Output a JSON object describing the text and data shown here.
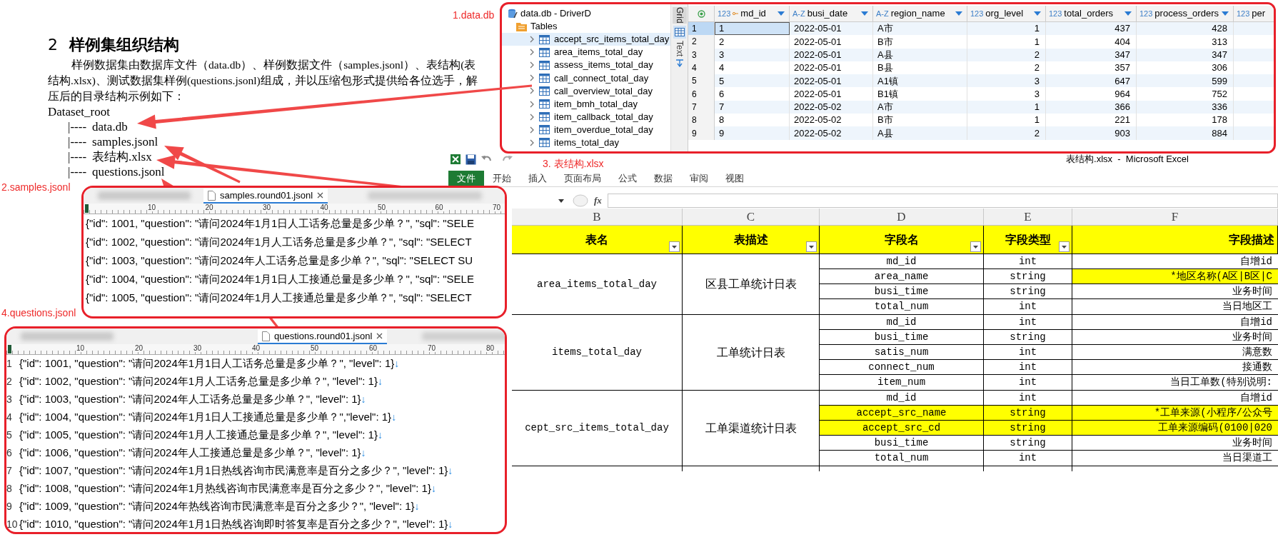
{
  "document": {
    "heading_number": "2",
    "heading": "样例集组织结构",
    "paragraph": "样例数据集由数据库文件（data.db）、样例数据文件（samples.jsonl）、表结构(表结构.xlsx)、测试数据集样例(questions.jsonl)组成，并以压缩包形式提供给各位选手，解压后的目录结构示例如下：",
    "tree_root": "Dataset_root",
    "tree": [
      {
        "prefix": "|----",
        "name": "data.db"
      },
      {
        "prefix": "|----",
        "name": "samples.jsonl"
      },
      {
        "prefix": "|----",
        "name": "表结构.xlsx"
      },
      {
        "prefix": "|----",
        "name": "questions.jsonl"
      }
    ]
  },
  "callout_labels": [
    "1.data.db",
    "2.samples.jsonl",
    "3. 表结构.xlsx",
    "4.questions.jsonl"
  ],
  "db_browser": {
    "title": "data.db - DriverD",
    "folder": "Tables",
    "tables": [
      {
        "name": "accept_src_items_total_day",
        "selected": true
      },
      {
        "name": "area_items_total_day",
        "selected": false
      },
      {
        "name": "assess_items_total_day",
        "selected": false
      },
      {
        "name": "call_connect_total_day",
        "selected": false
      },
      {
        "name": "call_overview_total_day",
        "selected": false
      },
      {
        "name": "item_bmh_total_day",
        "selected": false
      },
      {
        "name": "item_callback_total_day",
        "selected": false
      },
      {
        "name": "item_overdue_total_day",
        "selected": false
      },
      {
        "name": "items_total_day",
        "selected": false
      }
    ],
    "view_tabs": [
      {
        "label": "Grid",
        "selected": true
      },
      {
        "label": "Text",
        "selected": false
      }
    ],
    "columns": [
      {
        "type": "123",
        "name": "md_id",
        "key": true
      },
      {
        "type": "A-Z",
        "name": "busi_date",
        "key": false
      },
      {
        "type": "A-Z",
        "name": "region_name",
        "key": false
      },
      {
        "type": "123",
        "name": "org_level",
        "key": false
      },
      {
        "type": "123",
        "name": "total_orders",
        "key": false
      },
      {
        "type": "123",
        "name": "process_orders",
        "key": false
      },
      {
        "type": "123",
        "name": "per",
        "key": false
      }
    ],
    "rows": [
      {
        "number": "1",
        "selected": true,
        "cells": [
          "1",
          "2022-05-01",
          "A市",
          "1",
          "437",
          "428"
        ]
      },
      {
        "number": "2",
        "selected": false,
        "cells": [
          "2",
          "2022-05-01",
          "B市",
          "1",
          "404",
          "313"
        ]
      },
      {
        "number": "3",
        "selected": false,
        "cells": [
          "3",
          "2022-05-01",
          "A县",
          "2",
          "347",
          "347"
        ]
      },
      {
        "number": "4",
        "selected": false,
        "cells": [
          "4",
          "2022-05-01",
          "B县",
          "2",
          "357",
          "306"
        ]
      },
      {
        "number": "5",
        "selected": false,
        "cells": [
          "5",
          "2022-05-01",
          "A1镇",
          "3",
          "647",
          "599"
        ]
      },
      {
        "number": "6",
        "selected": false,
        "cells": [
          "6",
          "2022-05-01",
          "B1镇",
          "3",
          "964",
          "752"
        ]
      },
      {
        "number": "7",
        "selected": false,
        "cells": [
          "7",
          "2022-05-02",
          "A市",
          "1",
          "366",
          "336"
        ]
      },
      {
        "number": "8",
        "selected": false,
        "cells": [
          "8",
          "2022-05-02",
          "B市",
          "1",
          "221",
          "178"
        ]
      },
      {
        "number": "9",
        "selected": false,
        "cells": [
          "9",
          "2022-05-02",
          "A县",
          "2",
          "903",
          "884"
        ]
      }
    ]
  },
  "excel": {
    "window_title": "表结构.xlsx  -  Microsoft Excel",
    "ribbon_tabs": [
      {
        "label": "文件",
        "selected": true
      },
      {
        "label": "开始",
        "selected": false
      },
      {
        "label": "插入",
        "selected": false
      },
      {
        "label": "页面布局",
        "selected": false
      },
      {
        "label": "公式",
        "selected": false
      },
      {
        "label": "数据",
        "selected": false
      },
      {
        "label": "审阅",
        "selected": false
      },
      {
        "label": "视图",
        "selected": false
      }
    ],
    "formula_label": "fx",
    "column_letters": [
      "B",
      "C",
      "D",
      "E",
      "F"
    ],
    "headers": [
      {
        "label": "表名",
        "filter": true
      },
      {
        "label": "表描述",
        "filter": true
      },
      {
        "label": "字段名",
        "filter": true
      },
      {
        "label": "字段类型",
        "filter": true
      },
      {
        "label": "字段描述",
        "filter": false
      }
    ],
    "groups": [
      {
        "table": "area_items_total_day",
        "description": "区县工单统计日表",
        "fields": [
          {
            "name": "md_id",
            "type": "int",
            "description": "自增id",
            "highlighted": false,
            "description_highlighted": false
          },
          {
            "name": "area_name",
            "type": "string",
            "description": "*地区名称(A区|B区|C",
            "highlighted": false,
            "description_highlighted": true
          },
          {
            "name": "busi_time",
            "type": "string",
            "description": "业务时间",
            "highlighted": false,
            "description_highlighted": false
          },
          {
            "name": "total_num",
            "type": "int",
            "description": "当日地区工",
            "highlighted": false,
            "description_highlighted": false
          }
        ]
      },
      {
        "table": "items_total_day",
        "description": "工单统计日表",
        "fields": [
          {
            "name": "md_id",
            "type": "int",
            "description": "自增id",
            "highlighted": false,
            "description_highlighted": false
          },
          {
            "name": "busi_time",
            "type": "string",
            "description": "业务时间",
            "highlighted": false,
            "description_highlighted": false
          },
          {
            "name": "satis_num",
            "type": "int",
            "description": "满意数",
            "highlighted": false,
            "description_highlighted": false
          },
          {
            "name": "connect_num",
            "type": "int",
            "description": "接通数",
            "highlighted": false,
            "description_highlighted": false
          },
          {
            "name": "item_num",
            "type": "int",
            "description": "当日工单数(特别说明:",
            "highlighted": false,
            "description_highlighted": false
          }
        ]
      },
      {
        "table": "cept_src_items_total_day",
        "description": "工单渠道统计日表",
        "fields": [
          {
            "name": "md_id",
            "type": "int",
            "description": "自增id",
            "highlighted": false,
            "description_highlighted": false
          },
          {
            "name": "accept_src_name",
            "type": "string",
            "description": "*工单来源(小程序/公众号",
            "highlighted": true,
            "description_highlighted": true
          },
          {
            "name": "accept_src_cd",
            "type": "string",
            "description": "工单来源编码(0100|020",
            "highlighted": true,
            "description_highlighted": true
          },
          {
            "name": "busi_time",
            "type": "string",
            "description": "业务时间",
            "highlighted": false,
            "description_highlighted": false
          },
          {
            "name": "total_num",
            "type": "int",
            "description": "当日渠道工",
            "highlighted": false,
            "description_highlighted": false
          }
        ]
      }
    ]
  },
  "samples_editor": {
    "tab": "samples.round01.jsonl",
    "ruler": [
      "10",
      "20",
      "30",
      "40",
      "50",
      "60",
      "70"
    ],
    "lines": [
      "{\"id\": 1001, \"question\": \"请问2024年1月1日人工话务总量是多少单？\", \"sql\": \"SELE",
      "{\"id\": 1002, \"question\": \"请问2024年1月人工话务总量是多少单？\", \"sql\": \"SELECT",
      "{\"id\": 1003, \"question\": \"请问2024年人工话务总量是多少单？\", \"sql\": \"SELECT SU",
      "{\"id\": 1004, \"question\": \"请问2024年1月1日人工接通总量是多少单？\", \"sql\": \"SELE",
      "{\"id\": 1005, \"question\": \"请问2024年1月人工接通总量是多少单？\", \"sql\": \"SELECT"
    ]
  },
  "questions_editor": {
    "tab": "questions.round01.jsonl",
    "ruler": [
      "10",
      "20",
      "30",
      "40",
      "50",
      "60",
      "70",
      "80"
    ],
    "lines": [
      {
        "number": "1",
        "text": "{\"id\": 1001, \"question\": \"请问2024年1月1日人工话务总量是多少单？\", \"level\": 1}",
        "eol": "↓"
      },
      {
        "number": "2",
        "text": "{\"id\": 1002, \"question\": \"请问2024年1月人工话务总量是多少单？\", \"level\": 1}",
        "eol": "↓"
      },
      {
        "number": "3",
        "text": "{\"id\": 1003, \"question\": \"请问2024年人工话务总量是多少单？\", \"level\": 1}",
        "eol": "↓"
      },
      {
        "number": "4",
        "text": "{\"id\": 1004, \"question\": \"请问2024年1月1日人工接通总量是多少单？\",\"level\": 1}",
        "eol": "↓"
      },
      {
        "number": "5",
        "text": "{\"id\": 1005, \"question\": \"请问2024年1月人工接通总量是多少单？\", \"level\": 1}",
        "eol": "↓"
      },
      {
        "number": "6",
        "text": "{\"id\": 1006, \"question\": \"请问2024年人工接通总量是多少单？\", \"level\": 1}",
        "eol": "↓"
      },
      {
        "number": "7",
        "text": "{\"id\": 1007, \"question\": \"请问2024年1月1日热线咨询市民满意率是百分之多少？\", \"level\": 1}",
        "eol": "↓"
      },
      {
        "number": "8",
        "text": "{\"id\": 1008, \"question\": \"请问2024年1月热线咨询市民满意率是百分之多少？\", \"level\": 1}",
        "eol": "↓"
      },
      {
        "number": "9",
        "text": "{\"id\": 1009, \"question\": \"请问2024年热线咨询市民满意率是百分之多少？\", \"level\": 1}",
        "eol": "↓"
      },
      {
        "number": "10",
        "text": "{\"id\": 1010, \"question\": \"请问2024年1月1日热线咨询即时答复率是百分之多少？\", \"level\": 1}",
        "eol": "↓"
      }
    ]
  }
}
